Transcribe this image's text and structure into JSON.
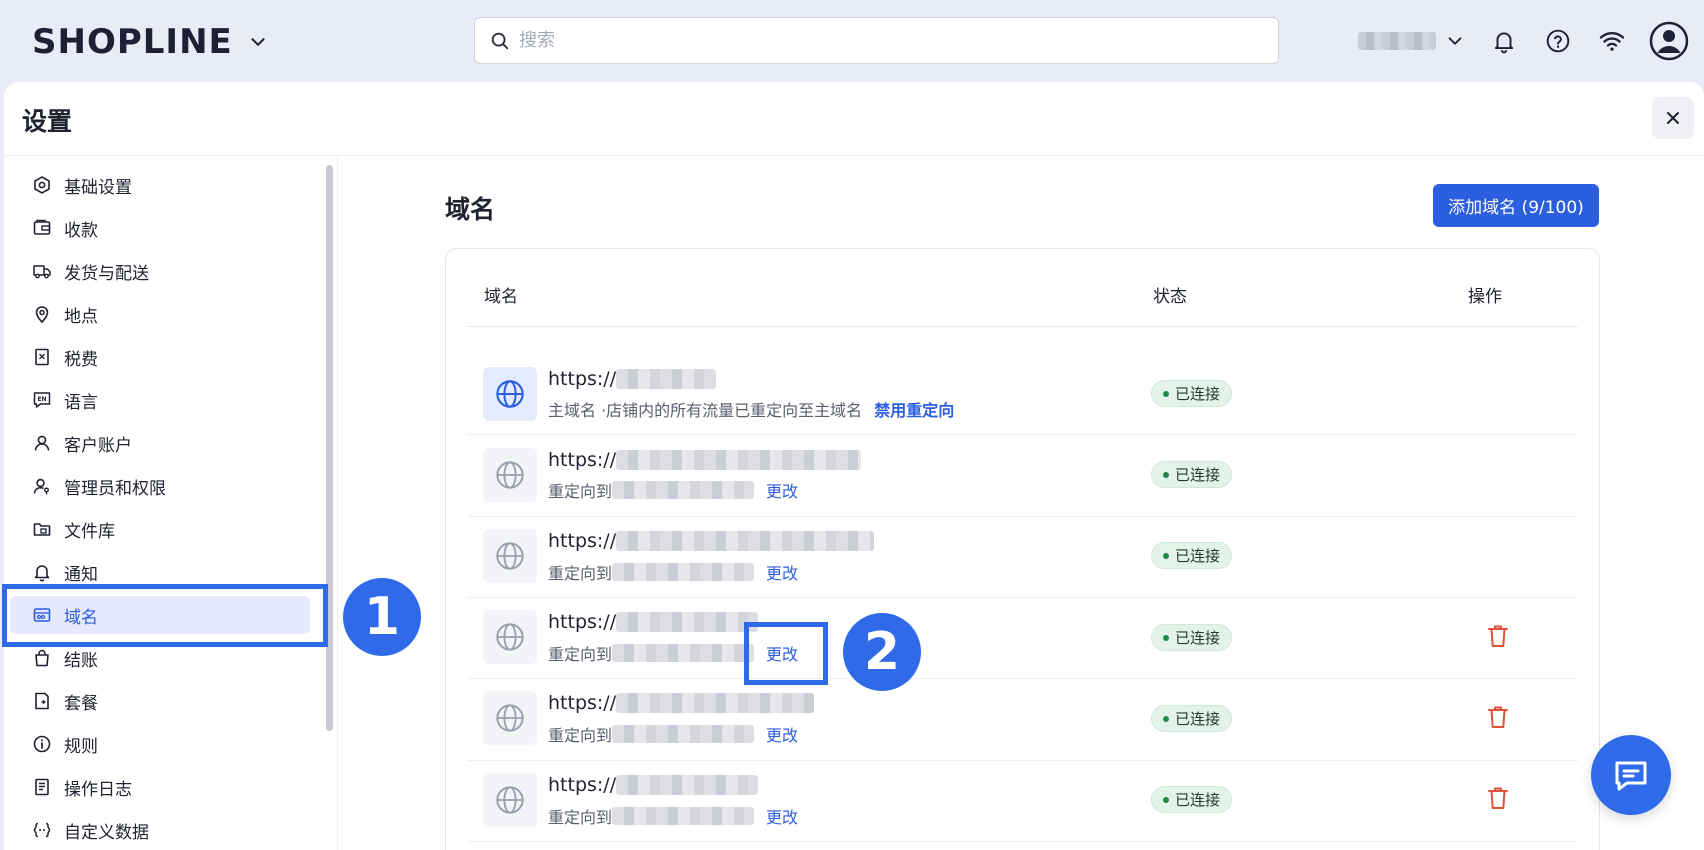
{
  "header": {
    "logo": "SHOPLINE",
    "search_placeholder": "搜索"
  },
  "panel": {
    "title": "设置",
    "close": "×"
  },
  "sidebar": {
    "items": [
      {
        "label": "基础设置",
        "icon": "settings-hex-icon"
      },
      {
        "label": "收款",
        "icon": "wallet-icon"
      },
      {
        "label": "发货与配送",
        "icon": "truck-icon"
      },
      {
        "label": "地点",
        "icon": "location-pin-icon"
      },
      {
        "label": "税费",
        "icon": "tax-receipt-icon"
      },
      {
        "label": "语言",
        "icon": "language-en-icon"
      },
      {
        "label": "客户账户",
        "icon": "user-icon"
      },
      {
        "label": "管理员和权限",
        "icon": "user-key-icon"
      },
      {
        "label": "文件库",
        "icon": "folder-icon"
      },
      {
        "label": "通知",
        "icon": "bell-icon"
      },
      {
        "label": "域名",
        "icon": "domain-icon",
        "active": true
      },
      {
        "label": "结账",
        "icon": "bag-icon"
      },
      {
        "label": "套餐",
        "icon": "plan-icon"
      },
      {
        "label": "规则",
        "icon": "info-icon"
      },
      {
        "label": "操作日志",
        "icon": "log-icon"
      },
      {
        "label": "自定义数据",
        "icon": "custom-data-icon"
      }
    ]
  },
  "annotations": [
    "1",
    "2"
  ],
  "content": {
    "title": "域名",
    "add_button": "添加域名 (9/100)",
    "columns": {
      "domain": "域名",
      "status": "状态",
      "action": "操作"
    },
    "rows": [
      {
        "url_prefix": "https://",
        "note": "主域名 ·店铺内的所有流量已重定向至主域名",
        "link": "禁用重定向",
        "status": "已连接",
        "primary": true
      },
      {
        "url_prefix": "https://",
        "note": "重定向到",
        "link": "更改",
        "status": "已连接"
      },
      {
        "url_prefix": "https://",
        "note": "重定向到",
        "link": "更改",
        "status": "已连接"
      },
      {
        "url_prefix": "https://",
        "note": "重定向到",
        "link": "更改",
        "status": "已连接",
        "deletable": true
      },
      {
        "url_prefix": "https://",
        "note": "重定向到",
        "link": "更改",
        "status": "已连接",
        "deletable": true
      },
      {
        "url_prefix": "https://",
        "note": "重定向到",
        "link": "更改",
        "status": "已连接",
        "deletable": true
      }
    ]
  },
  "colors": {
    "accent": "#2c5ee0",
    "annotation": "#2f6be8",
    "status_bg": "#e4f3ea",
    "status_dot": "#1f8a4c",
    "trash": "#e0533a"
  }
}
